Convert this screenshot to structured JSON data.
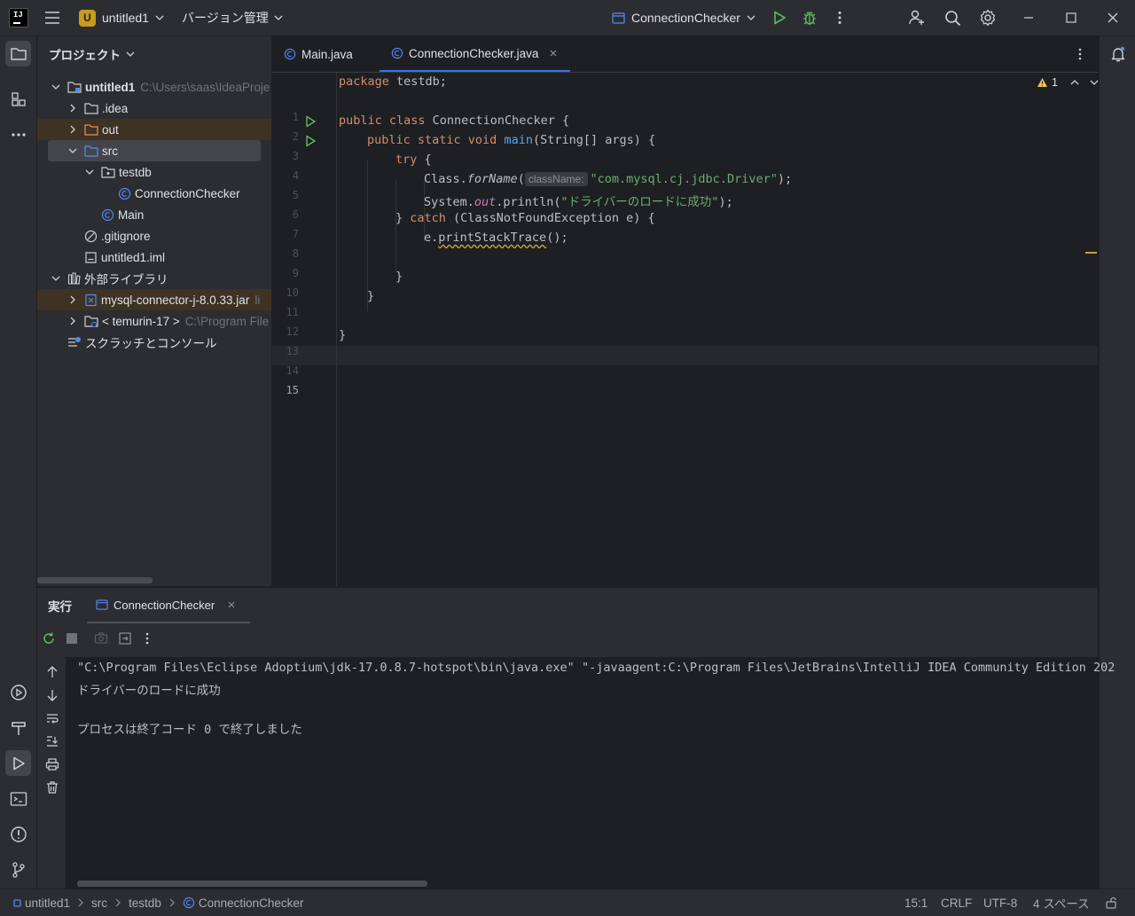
{
  "titlebar": {
    "project_badge": "U",
    "project_name": "untitled1",
    "vcs_label": "バージョン管理",
    "run_config": "ConnectionChecker"
  },
  "project_panel": {
    "title": "プロジェクト",
    "tree": [
      {
        "label": "untitled1",
        "hint": "C:\\Users\\saas\\IdeaProje"
      },
      {
        "label": ".idea"
      },
      {
        "label": "out"
      },
      {
        "label": "src"
      },
      {
        "label": "testdb"
      },
      {
        "label": "ConnectionChecker"
      },
      {
        "label": "Main"
      },
      {
        "label": ".gitignore"
      },
      {
        "label": "untitled1.iml"
      },
      {
        "label": "外部ライブラリ"
      },
      {
        "label": "mysql-connector-j-8.0.33.jar",
        "hint": "li"
      },
      {
        "label": "< temurin-17 >",
        "hint": "C:\\Program File"
      },
      {
        "label": "スクラッチとコンソール"
      }
    ]
  },
  "editor": {
    "tabs": [
      {
        "label": "Main.java"
      },
      {
        "label": "ConnectionChecker.java"
      }
    ],
    "warning_count": "1",
    "line_numbers": [
      "1",
      "2",
      "3",
      "4",
      "5",
      "6",
      "7",
      "8",
      "9",
      "10",
      "11",
      "12",
      "13",
      "14",
      "15"
    ],
    "inlay_hint": "className:",
    "code": {
      "l1_kw": "package",
      "l1_rest": " testdb;",
      "l3_kw": "public class",
      "l3_rest": " ConnectionChecker {",
      "l4_kw": "public static void",
      "l4_fn": "main",
      "l4_rest": "(String[] args) {",
      "l5_kw": "try",
      "l5_rest": " {",
      "l6_a": "Class.",
      "l6_method": "forName",
      "l6_b": "(",
      "l6_str": "\"com.mysql.cj.jdbc.Driver\"",
      "l6_c": ");",
      "l7_a": "System.",
      "l7_field": "out",
      "l7_b": ".println(",
      "l7_str": "\"ドライバーのロードに成功\"",
      "l7_c": ");",
      "l8_a": "} ",
      "l8_kw": "catch",
      "l8_rest": " (ClassNotFoundException e) {",
      "l9_a": "e.",
      "l9_method": "printStackTrace",
      "l9_b": "();",
      "l11": "}",
      "l12": "}",
      "l14": "}"
    }
  },
  "run_panel": {
    "title": "実行",
    "tab_label": "ConnectionChecker",
    "console": [
      "\"C:\\Program Files\\Eclipse Adoptium\\jdk-17.0.8.7-hotspot\\bin\\java.exe\" \"-javaagent:C:\\Program Files\\JetBrains\\IntelliJ IDEA Community Edition 202",
      "ドライバーのロードに成功",
      "",
      "プロセスは終了コード 0 で終了しました"
    ]
  },
  "statusbar": {
    "breadcrumbs": [
      "untitled1",
      "src",
      "testdb",
      "ConnectionChecker"
    ],
    "position": "15:1",
    "line_sep": "CRLF",
    "encoding": "UTF-8",
    "indent": "4 スペース"
  },
  "colors": {
    "accent": "#3574f0",
    "run_green": "#5fb865",
    "keyword": "#cf8e6d",
    "string": "#6aab73",
    "warning": "#f2c55c"
  }
}
